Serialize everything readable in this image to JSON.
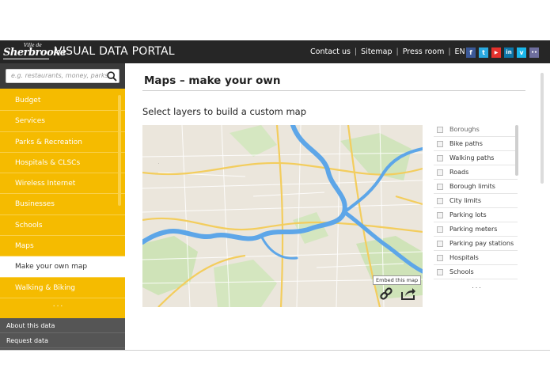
{
  "header": {
    "logo_ville": "Ville de",
    "logo_name": "Sherbrooke",
    "title": "VISUAL DATA PORTAL",
    "nav": [
      "Contact us",
      "Sitemap",
      "Press room",
      "EN"
    ],
    "social": [
      {
        "name": "facebook",
        "glyph": "f",
        "color": "#3b5998"
      },
      {
        "name": "twitter",
        "glyph": "t",
        "color": "#2aa9e0"
      },
      {
        "name": "youtube",
        "glyph": "▶",
        "color": "#e5322d"
      },
      {
        "name": "linkedin",
        "glyph": "in",
        "color": "#0e76a8"
      },
      {
        "name": "vimeo",
        "glyph": "v",
        "color": "#1ab7ea"
      },
      {
        "name": "flickr",
        "glyph": "••",
        "color": "#6e6e9e"
      }
    ]
  },
  "sidebar": {
    "search_placeholder": "e.g. restaurants, money, parks...",
    "items": [
      {
        "label": "Budget"
      },
      {
        "label": "Services"
      },
      {
        "label": "Parks & Recreation"
      },
      {
        "label": "Hospitals & CLSCs"
      },
      {
        "label": "Wireless Internet"
      },
      {
        "label": "Businesses"
      },
      {
        "label": "Schools"
      },
      {
        "label": "Maps"
      },
      {
        "label": "Make your own map"
      },
      {
        "label": "Walking & Biking"
      }
    ],
    "more": "...",
    "bottom": [
      {
        "label": "About this data"
      },
      {
        "label": "Request data"
      }
    ]
  },
  "main": {
    "title": "Maps – make your own",
    "subtitle": "Select layers to build a custom map",
    "embed_tooltip": "Embed this map",
    "layers": [
      {
        "label": "Boroughs"
      },
      {
        "label": "Bike paths"
      },
      {
        "label": "Walking paths"
      },
      {
        "label": "Roads"
      },
      {
        "label": "Borough limits"
      },
      {
        "label": "City limits"
      },
      {
        "label": "Parking lots"
      },
      {
        "label": "Parking meters"
      },
      {
        "label": "Parking pay stations"
      },
      {
        "label": "Hospitals"
      },
      {
        "label": "Schools"
      }
    ],
    "layers_more": "..."
  },
  "colors": {
    "accent": "#f5bb00",
    "topbar": "#262626",
    "river": "#5da6e8",
    "road": "#f3cd5d"
  }
}
